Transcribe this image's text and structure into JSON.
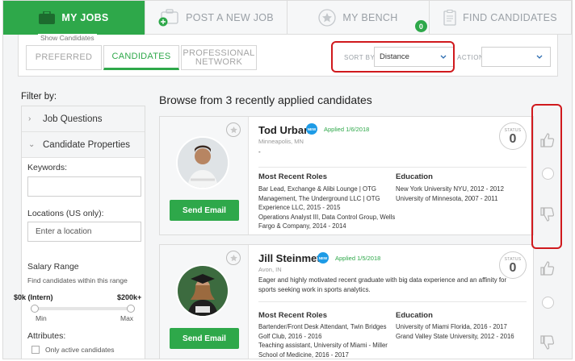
{
  "nav": {
    "tabs": [
      {
        "label": "MY JOBS",
        "icon": "briefcase-icon",
        "active": true
      },
      {
        "label": "POST A NEW JOB",
        "icon": "add-briefcase-icon",
        "active": false
      },
      {
        "label": "MY BENCH",
        "icon": "star-icon",
        "active": false,
        "badge": "0"
      },
      {
        "label": "FIND CANDIDATES",
        "icon": "document-icon",
        "active": false
      }
    ]
  },
  "show": {
    "label": "Show Candidates",
    "pills": [
      "PREFERRED",
      "CANDIDATES",
      "PROFESSIONAL NETWORK"
    ],
    "active_pill": "CANDIDATES",
    "sort_label": "SORT BY",
    "sort_value": "Distance",
    "action_label": "ACTION",
    "action_value": ""
  },
  "filter": {
    "title": "Filter by:",
    "sections": [
      "Job Questions",
      "Candidate Properties"
    ],
    "keywords_label": "Keywords:",
    "keywords_value": "",
    "locations_label": "Locations (US only):",
    "locations_placeholder": "Enter a location",
    "salary_label": "Salary Range",
    "salary_hint": "Find candidates within this range",
    "salary_min_value": "$0k (Intern)",
    "salary_max_value": "$200k+",
    "min_label": "Min",
    "max_label": "Max",
    "attributes_label": "Attributes:",
    "only_active_label": "Only active candidates"
  },
  "main": {
    "heading": "Browse from 3 recently applied candidates",
    "candidates": [
      {
        "name": "Tod Urban",
        "badge": "NEW",
        "applied": "Applied 1/6/2018",
        "location": "Minneapolis, MN",
        "description": "-",
        "status_label": "STATUS",
        "status_value": "0",
        "send_label": "Send Email",
        "roles_title": "Most Recent Roles",
        "roles": "Bar Lead, Exchange & Alibi Lounge | OTG\nManagement, The Underground LLC | OTG\nExperience LLC, 2015 - 2015\nOperations Analyst III, Data Control Group, Wells\nFargo & Company, 2014 - 2014",
        "edu_title": "Education",
        "education": "New York University NYU, 2012 - 2012\nUniversity of Minnesota, 2007 - 2011"
      },
      {
        "name": "Jill Steinmetz",
        "badge": "NEW",
        "applied": "Applied 1/5/2018",
        "location": "Avon, IN",
        "description": "Eager and highly motivated recent graduate with big data experience and an affinity for sports seeking work in sports analytics.",
        "status_label": "STATUS",
        "status_value": "0",
        "send_label": "Send Email",
        "roles_title": "Most Recent Roles",
        "roles": "Bartender/Front Desk Attendant, Twin Bridges\nGolf Club, 2016 - 2016\nTeaching assistant, University of Miami - Miller\nSchool of Medicine, 2016 - 2017",
        "edu_title": "Education",
        "education": "University of Miami Florida, 2016 - 2017\nGrand Valley State University, 2012 - 2016"
      }
    ]
  },
  "colors": {
    "accent": "#2ea84a",
    "highlight": "#d0191d",
    "badge": "#1d9be6"
  }
}
